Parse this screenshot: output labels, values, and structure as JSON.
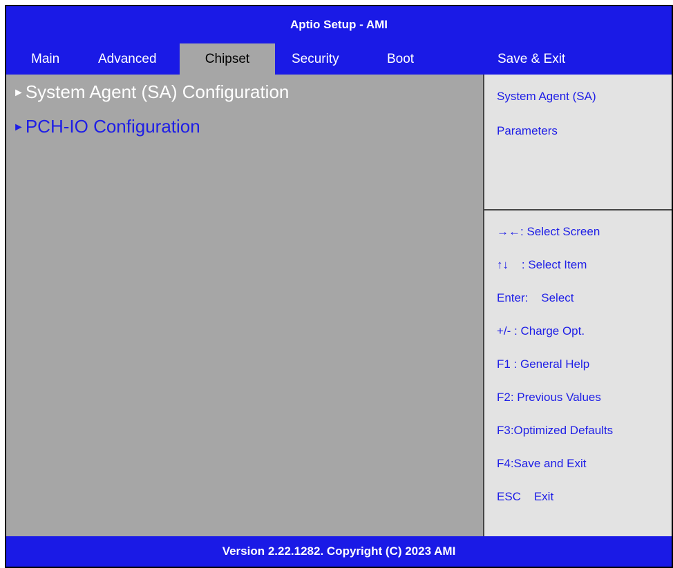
{
  "title": "Aptio Setup - AMI",
  "tabs": [
    {
      "label": "Main"
    },
    {
      "label": "Advanced"
    },
    {
      "label": "Chipset"
    },
    {
      "label": "Security"
    },
    {
      "label": "Boot"
    },
    {
      "label": "Save & Exit"
    }
  ],
  "active_tab": "Chipset",
  "menu": {
    "arrow": "►",
    "items": [
      {
        "label": "System Agent (SA) Configuration"
      },
      {
        "label": "PCH-IO Configuration"
      }
    ]
  },
  "help": {
    "lines": [
      "System Agent (SA)",
      "Parameters"
    ]
  },
  "keys": [
    "→←: Select Screen",
    "↑↓    : Select Item",
    "Enter:    Select",
    "+/- : Charge Opt.",
    "F1 : General Help",
    "F2: Previous Values",
    "F3:Optimized Defaults",
    "F4:Save and Exit",
    "ESC    Exit"
  ],
  "footer": "Version 2.22.1282. Copyright (C) 2023 AMI",
  "colors": {
    "header_blue": "#1a1ae6",
    "panel_gray": "#a6a6a6",
    "help_bg": "#e3e3e3",
    "highlight_text": "#1e1ee6"
  }
}
